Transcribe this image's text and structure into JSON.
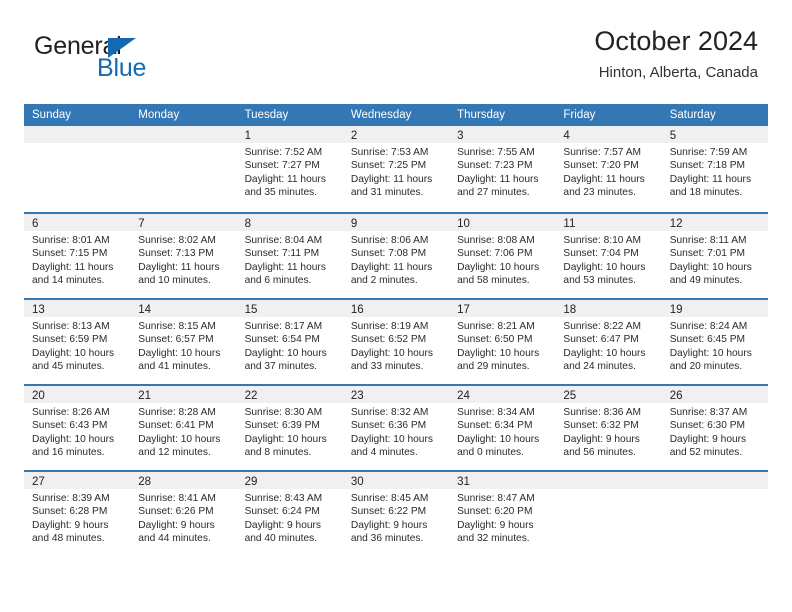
{
  "brand": {
    "name_part1": "General",
    "name_part2": "Blue",
    "triangle_color": "#1469b0",
    "icon": "triangle-logo-icon"
  },
  "header": {
    "title": "October 2024",
    "subtitle": "Hinton, Alberta, Canada",
    "accent_color": "#3477b5",
    "band_color": "#f0f0f0"
  },
  "weekday_headers": [
    "Sunday",
    "Monday",
    "Tuesday",
    "Wednesday",
    "Thursday",
    "Friday",
    "Saturday"
  ],
  "weeks": [
    [
      {
        "day": "",
        "lines": []
      },
      {
        "day": "",
        "lines": []
      },
      {
        "day": "1",
        "lines": [
          "Sunrise: 7:52 AM",
          "Sunset: 7:27 PM",
          "Daylight: 11 hours",
          "and 35 minutes."
        ]
      },
      {
        "day": "2",
        "lines": [
          "Sunrise: 7:53 AM",
          "Sunset: 7:25 PM",
          "Daylight: 11 hours",
          "and 31 minutes."
        ]
      },
      {
        "day": "3",
        "lines": [
          "Sunrise: 7:55 AM",
          "Sunset: 7:23 PM",
          "Daylight: 11 hours",
          "and 27 minutes."
        ]
      },
      {
        "day": "4",
        "lines": [
          "Sunrise: 7:57 AM",
          "Sunset: 7:20 PM",
          "Daylight: 11 hours",
          "and 23 minutes."
        ]
      },
      {
        "day": "5",
        "lines": [
          "Sunrise: 7:59 AM",
          "Sunset: 7:18 PM",
          "Daylight: 11 hours",
          "and 18 minutes."
        ]
      }
    ],
    [
      {
        "day": "6",
        "lines": [
          "Sunrise: 8:01 AM",
          "Sunset: 7:15 PM",
          "Daylight: 11 hours",
          "and 14 minutes."
        ]
      },
      {
        "day": "7",
        "lines": [
          "Sunrise: 8:02 AM",
          "Sunset: 7:13 PM",
          "Daylight: 11 hours",
          "and 10 minutes."
        ]
      },
      {
        "day": "8",
        "lines": [
          "Sunrise: 8:04 AM",
          "Sunset: 7:11 PM",
          "Daylight: 11 hours",
          "and 6 minutes."
        ]
      },
      {
        "day": "9",
        "lines": [
          "Sunrise: 8:06 AM",
          "Sunset: 7:08 PM",
          "Daylight: 11 hours",
          "and 2 minutes."
        ]
      },
      {
        "day": "10",
        "lines": [
          "Sunrise: 8:08 AM",
          "Sunset: 7:06 PM",
          "Daylight: 10 hours",
          "and 58 minutes."
        ]
      },
      {
        "day": "11",
        "lines": [
          "Sunrise: 8:10 AM",
          "Sunset: 7:04 PM",
          "Daylight: 10 hours",
          "and 53 minutes."
        ]
      },
      {
        "day": "12",
        "lines": [
          "Sunrise: 8:11 AM",
          "Sunset: 7:01 PM",
          "Daylight: 10 hours",
          "and 49 minutes."
        ]
      }
    ],
    [
      {
        "day": "13",
        "lines": [
          "Sunrise: 8:13 AM",
          "Sunset: 6:59 PM",
          "Daylight: 10 hours",
          "and 45 minutes."
        ]
      },
      {
        "day": "14",
        "lines": [
          "Sunrise: 8:15 AM",
          "Sunset: 6:57 PM",
          "Daylight: 10 hours",
          "and 41 minutes."
        ]
      },
      {
        "day": "15",
        "lines": [
          "Sunrise: 8:17 AM",
          "Sunset: 6:54 PM",
          "Daylight: 10 hours",
          "and 37 minutes."
        ]
      },
      {
        "day": "16",
        "lines": [
          "Sunrise: 8:19 AM",
          "Sunset: 6:52 PM",
          "Daylight: 10 hours",
          "and 33 minutes."
        ]
      },
      {
        "day": "17",
        "lines": [
          "Sunrise: 8:21 AM",
          "Sunset: 6:50 PM",
          "Daylight: 10 hours",
          "and 29 minutes."
        ]
      },
      {
        "day": "18",
        "lines": [
          "Sunrise: 8:22 AM",
          "Sunset: 6:47 PM",
          "Daylight: 10 hours",
          "and 24 minutes."
        ]
      },
      {
        "day": "19",
        "lines": [
          "Sunrise: 8:24 AM",
          "Sunset: 6:45 PM",
          "Daylight: 10 hours",
          "and 20 minutes."
        ]
      }
    ],
    [
      {
        "day": "20",
        "lines": [
          "Sunrise: 8:26 AM",
          "Sunset: 6:43 PM",
          "Daylight: 10 hours",
          "and 16 minutes."
        ]
      },
      {
        "day": "21",
        "lines": [
          "Sunrise: 8:28 AM",
          "Sunset: 6:41 PM",
          "Daylight: 10 hours",
          "and 12 minutes."
        ]
      },
      {
        "day": "22",
        "lines": [
          "Sunrise: 8:30 AM",
          "Sunset: 6:39 PM",
          "Daylight: 10 hours",
          "and 8 minutes."
        ]
      },
      {
        "day": "23",
        "lines": [
          "Sunrise: 8:32 AM",
          "Sunset: 6:36 PM",
          "Daylight: 10 hours",
          "and 4 minutes."
        ]
      },
      {
        "day": "24",
        "lines": [
          "Sunrise: 8:34 AM",
          "Sunset: 6:34 PM",
          "Daylight: 10 hours",
          "and 0 minutes."
        ]
      },
      {
        "day": "25",
        "lines": [
          "Sunrise: 8:36 AM",
          "Sunset: 6:32 PM",
          "Daylight: 9 hours",
          "and 56 minutes."
        ]
      },
      {
        "day": "26",
        "lines": [
          "Sunrise: 8:37 AM",
          "Sunset: 6:30 PM",
          "Daylight: 9 hours",
          "and 52 minutes."
        ]
      }
    ],
    [
      {
        "day": "27",
        "lines": [
          "Sunrise: 8:39 AM",
          "Sunset: 6:28 PM",
          "Daylight: 9 hours",
          "and 48 minutes."
        ]
      },
      {
        "day": "28",
        "lines": [
          "Sunrise: 8:41 AM",
          "Sunset: 6:26 PM",
          "Daylight: 9 hours",
          "and 44 minutes."
        ]
      },
      {
        "day": "29",
        "lines": [
          "Sunrise: 8:43 AM",
          "Sunset: 6:24 PM",
          "Daylight: 9 hours",
          "and 40 minutes."
        ]
      },
      {
        "day": "30",
        "lines": [
          "Sunrise: 8:45 AM",
          "Sunset: 6:22 PM",
          "Daylight: 9 hours",
          "and 36 minutes."
        ]
      },
      {
        "day": "31",
        "lines": [
          "Sunrise: 8:47 AM",
          "Sunset: 6:20 PM",
          "Daylight: 9 hours",
          "and 32 minutes."
        ]
      },
      {
        "day": "",
        "lines": []
      },
      {
        "day": "",
        "lines": []
      }
    ]
  ]
}
